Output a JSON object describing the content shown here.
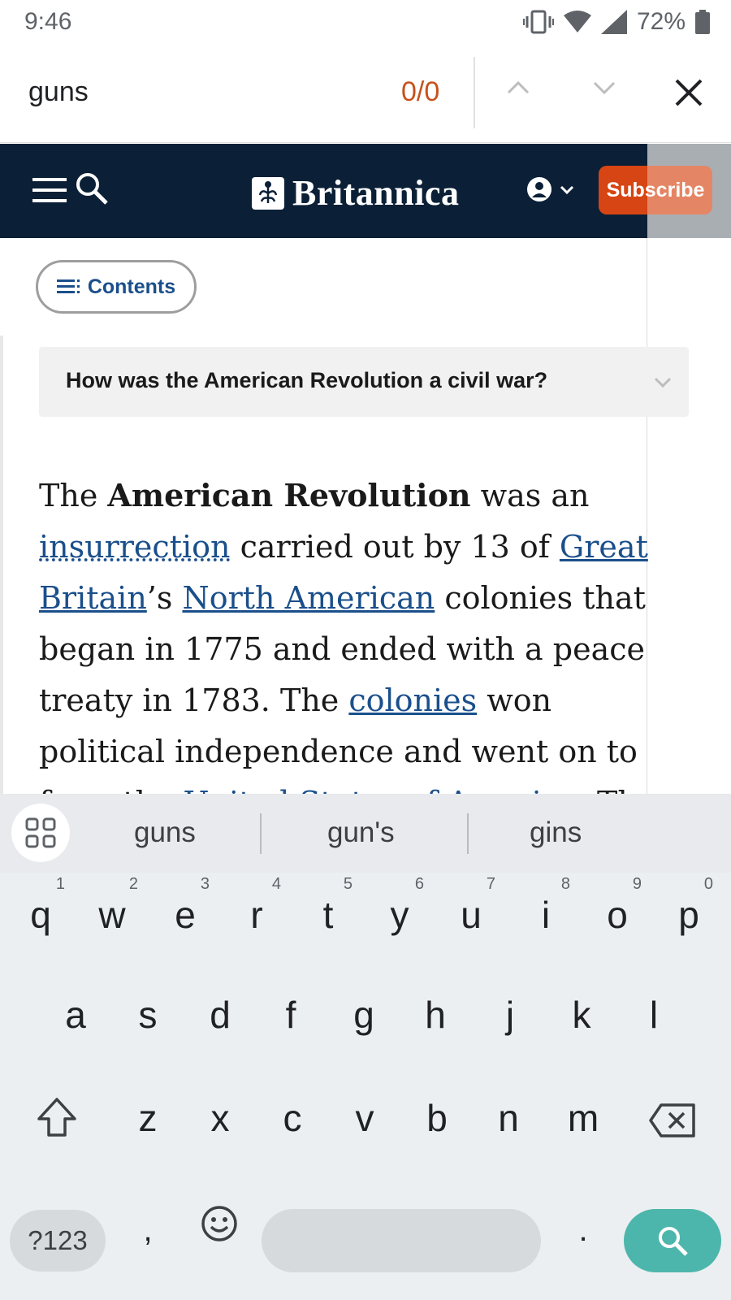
{
  "status_bar": {
    "time": "9:46",
    "battery": "72%"
  },
  "find_bar": {
    "query": "guns",
    "match_count": "0/0"
  },
  "header": {
    "brand": "Britannica",
    "subscribe_label": "Subscribe"
  },
  "contents_button": {
    "label": "Contents"
  },
  "faq": {
    "question": "How was the American Revolution a civil war?"
  },
  "article": {
    "t1": "The ",
    "bold1": "American Revolution",
    "t2": " was an ",
    "link_insurrection": "insurrection",
    "t3": " carried out by 13 of ",
    "link_great_britain": "Great Britain",
    "t4": "’s ",
    "link_north_american": "North American",
    "t5": " colonies that began in 1775 and ended with a peace treaty in 1783. The ",
    "link_colonies": "colonies",
    "t6": " won political independence and went on to form the ",
    "link_usa": "United States of America",
    "t7": ". The"
  },
  "keyboard": {
    "suggestions": [
      "guns",
      "gun's",
      "gins"
    ],
    "row1": [
      {
        "k": "q",
        "h": "1"
      },
      {
        "k": "w",
        "h": "2"
      },
      {
        "k": "e",
        "h": "3"
      },
      {
        "k": "r",
        "h": "4"
      },
      {
        "k": "t",
        "h": "5"
      },
      {
        "k": "y",
        "h": "6"
      },
      {
        "k": "u",
        "h": "7"
      },
      {
        "k": "i",
        "h": "8"
      },
      {
        "k": "o",
        "h": "9"
      },
      {
        "k": "p",
        "h": "0"
      }
    ],
    "row2": [
      "a",
      "s",
      "d",
      "f",
      "g",
      "h",
      "j",
      "k",
      "l"
    ],
    "row3": [
      "z",
      "x",
      "c",
      "v",
      "b",
      "n",
      "m"
    ],
    "symbols_label": "?123",
    "comma": ",",
    "period": "."
  },
  "colors": {
    "brand_navy": "#0b2037",
    "subscribe": "#d64513",
    "link": "#1a4f8b",
    "match_count": "#c5521d",
    "search_key": "#4db6ac"
  }
}
